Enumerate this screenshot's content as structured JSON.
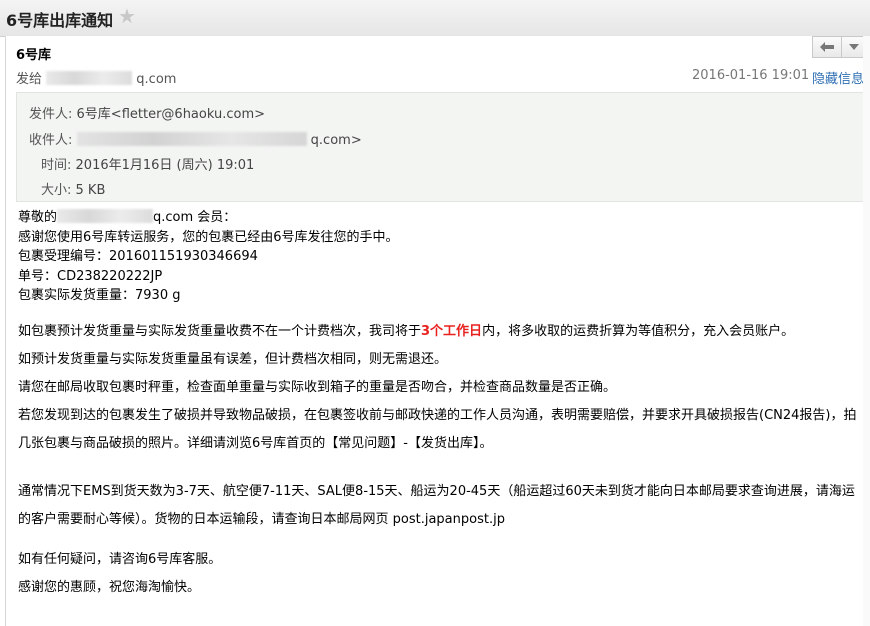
{
  "title": {
    "subject": "6号库出库通知"
  },
  "header": {
    "sender": "6号库",
    "to_prefix": "发给",
    "to_suffix": "q.com",
    "date": "2016-01-16 19:01",
    "hide_info": "隐藏信息"
  },
  "details": {
    "from_label": "发件人:",
    "from_value": "6号库<fletter@6haoku.com>",
    "to_label": "收件人:",
    "to_value_tail": "q.com>",
    "time_label": "时间:",
    "time_value": "2016年1月16日 (周六) 19:01",
    "size_label": "大小:",
    "size_value": "5 KB"
  },
  "body": {
    "greeting_prefix": "尊敬的",
    "greeting_suffix": "q.com 会员：",
    "line1": "感谢您使用6号库转运服务，您的包裹已经由6号库发往您的手中。",
    "line2": "包裹受理编号：201601151930346694",
    "line3": "单号：CD238220222JP",
    "line4": "包裹实际发货重量：7930 g",
    "p1_before": "如包裹预计发货重量与实际发货重量收费不在一个计费档次，我司将于",
    "p1_red": "3个工作日",
    "p1_after": "内，将多收取的运费折算为等值积分，充入会员账户。",
    "p2": "如预计发货重量与实际发货重量虽有误差，但计费档次相同，则无需退还。",
    "p3": "请您在邮局收取包裹时秤重，检查面单重量与实际收到箱子的重量是否吻合，并检查商品数量是否正确。",
    "p4": "若您发现到达的包裹发生了破损并导致物品破损，在包裹签收前与邮政快递的工作人员沟通，表明需要赔偿，并要求开具破损报告(CN24报告)，拍几张包裹与商品破损的照片。详细请浏览6号库首页的【常见问题】-【发货出库】。",
    "p5": "通常情况下EMS到货天数为3-7天、航空便7-11天、SAL便8-15天、船运为20-45天（船运超过60天未到货才能向日本邮局要求查询进展，请海运的客户需要耐心等候）。货物的日本运输段，请查询日本邮局网页 post.japanpost.jp",
    "p6": "如有任何疑问，请咨询6号库客服。",
    "p7": "感谢您的惠顾，祝您海淘愉快。"
  },
  "icons": {
    "star": "star-icon",
    "reply": "reply-icon",
    "more": "chevron-down-icon"
  }
}
